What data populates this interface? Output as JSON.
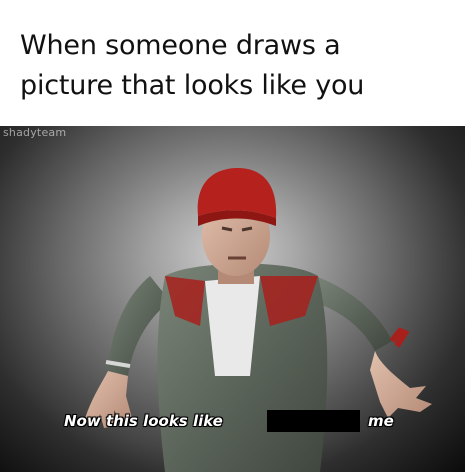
{
  "caption": {
    "line1": "When someone draws a",
    "line2": "picture that looks like you"
  },
  "frame": {
    "watermark": "shadyteam",
    "subtitle_start": "Now this looks like",
    "subtitle_end": "me"
  },
  "colors": {
    "hat": "#b5211d",
    "jacket": "#5f6a5e",
    "sleeve_trim": "#a8201c",
    "background_light": "#c9c9c9",
    "background_dark": "#0b0b0b"
  }
}
